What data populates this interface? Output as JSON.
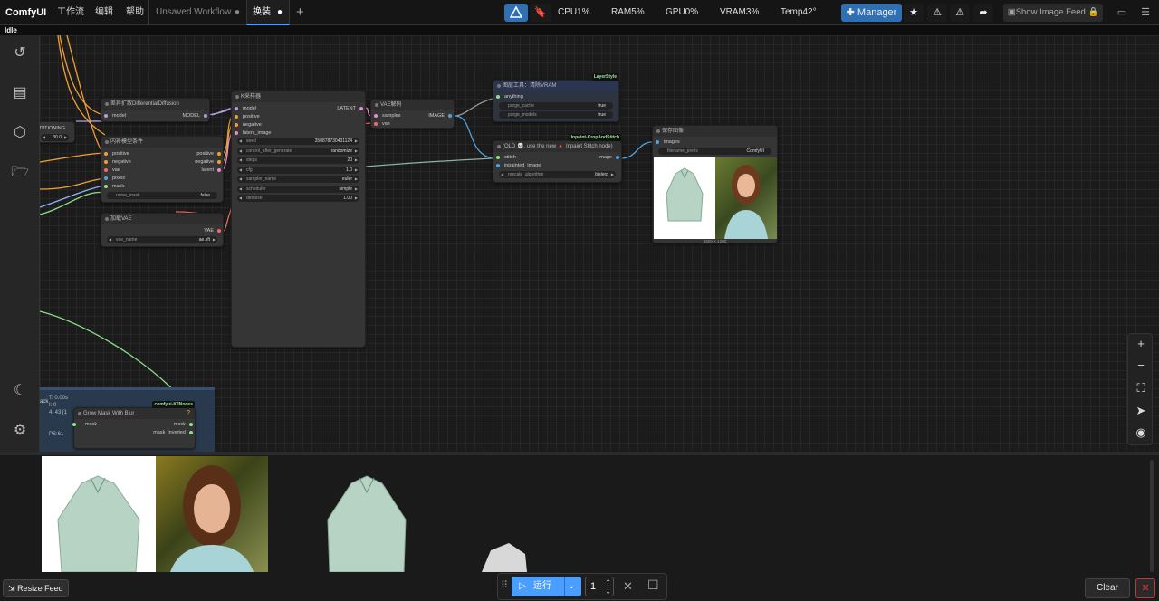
{
  "app": {
    "name": "ComfyUI"
  },
  "menu": {
    "workflow": "工作流",
    "edit": "编辑",
    "help": "帮助"
  },
  "tabs": [
    {
      "label": "Unsaved Workflow"
    },
    {
      "label": "换装"
    }
  ],
  "stats": {
    "cpu": "CPU1%",
    "ram": "RAM5%",
    "gpu": "GPU0%",
    "vram": "VRAM3%",
    "temp": "Temp42°"
  },
  "toolbar": {
    "manager": "Manager",
    "show_feed": "Show Image Feed"
  },
  "status": "Idle",
  "nodes": {
    "diff": {
      "title": "差异扩散DifferentialDiffusion",
      "in_model": "model",
      "out_model": "MODEL"
    },
    "cond": {
      "title": "内补模型条件",
      "positive": "positive",
      "negative": "negative",
      "vae": "vae",
      "pixels": "pixels",
      "mask": "mask",
      "out_positive": "positive",
      "out_negative": "negative",
      "out_latent": "latent",
      "noise_mask": "noise_mask",
      "noise_mask_val": "false"
    },
    "condleft": {
      "label": "NDITIONING",
      "val": "30.0"
    },
    "vaeload": {
      "title": "加载VAE",
      "out": "VAE",
      "vae_name": "vae_name",
      "vae_val": "ae.sft"
    },
    "ksampler": {
      "title": "K采样器",
      "model": "model",
      "positive": "positive",
      "negative": "negative",
      "latent": "latent_image",
      "out": "LATENT",
      "w": [
        {
          "l": "seed",
          "r": "350878730431124"
        },
        {
          "l": "control_after_generate",
          "r": "randomize"
        },
        {
          "l": "steps",
          "r": "20"
        },
        {
          "l": "cfg",
          "r": "1.0"
        },
        {
          "l": "sampler_name",
          "r": "euler"
        },
        {
          "l": "scheduler",
          "r": "simple"
        },
        {
          "l": "denoise",
          "r": "1.00"
        }
      ]
    },
    "vaedec": {
      "title": "VAE解码",
      "samples": "samples",
      "vae": "vae",
      "out": "IMAGE"
    },
    "layer": {
      "badge": "LayerStyle",
      "title": "图层工具：清除VRAM",
      "anything": "anything",
      "purge_cache": "purge_cache",
      "purge_cache_val": "true",
      "purge_models": "purge_models",
      "purge_models_val": "true"
    },
    "stitch": {
      "badge": "Inpaint-CropAndStitch",
      "title": "(OLD 💀, use the new 🔺 Inpaint Stitch node)",
      "stitch": "stitch",
      "inpainted": "inpainted_image",
      "out": "image",
      "rescale": "rescale_algorithm",
      "rescale_val": "bislerp"
    },
    "save": {
      "title": "保存图像",
      "images": "images",
      "prefix": "filename_prefix",
      "prefix_val": "ComfyUI",
      "size": "1600 × 1200"
    },
    "grow": {
      "badge": "comfyui-KJNodes",
      "title": "Grow Mask With Blur",
      "mask": "mask",
      "out_mask": "mask",
      "out_inv": "mask_inverted"
    },
    "info": {
      "l1": "T: 0.00s",
      "l2": "I: 0",
      "l3": "4: 43 [1",
      "l4": "PS:61",
      "l5": "ack"
    }
  },
  "run": {
    "label": "运行",
    "count": "1"
  },
  "feed": {
    "resize": "Resize Feed",
    "clear": "Clear"
  },
  "colors": {
    "accent": "#2f6fb3",
    "run": "#4a9eff",
    "badge": "#9fe0a0"
  }
}
